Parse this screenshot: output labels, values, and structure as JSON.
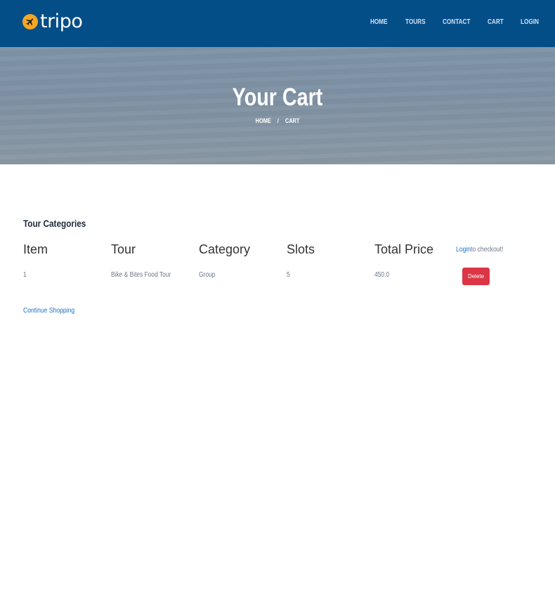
{
  "brand": {
    "name": "tripo",
    "icon": "plane-icon",
    "icon_color": "#f5a623"
  },
  "nav": {
    "bg_color": "#044e88",
    "items": [
      {
        "label": "HOME"
      },
      {
        "label": "TOURS"
      },
      {
        "label": "CONTACT"
      },
      {
        "label": "CART"
      },
      {
        "label": "LOGIN"
      }
    ]
  },
  "hero": {
    "title": "Your Cart",
    "breadcrumb": {
      "home": "HOME",
      "separator": "/",
      "current": "CART"
    }
  },
  "cart": {
    "section_title": "Tour Categories",
    "columns": [
      "Item",
      "Tour",
      "Category",
      "Slots",
      "Total Price"
    ],
    "checkout_note": {
      "link": "Login",
      "text": "to checkout!"
    },
    "rows": [
      {
        "item": "1",
        "tour": "Bike & Bites Food Tour",
        "category": "Group",
        "slots": "5",
        "total_price": "450.0",
        "action": "Delete"
      }
    ],
    "delete_color": "#dc3545",
    "continue_label": "Continue Shopping"
  }
}
